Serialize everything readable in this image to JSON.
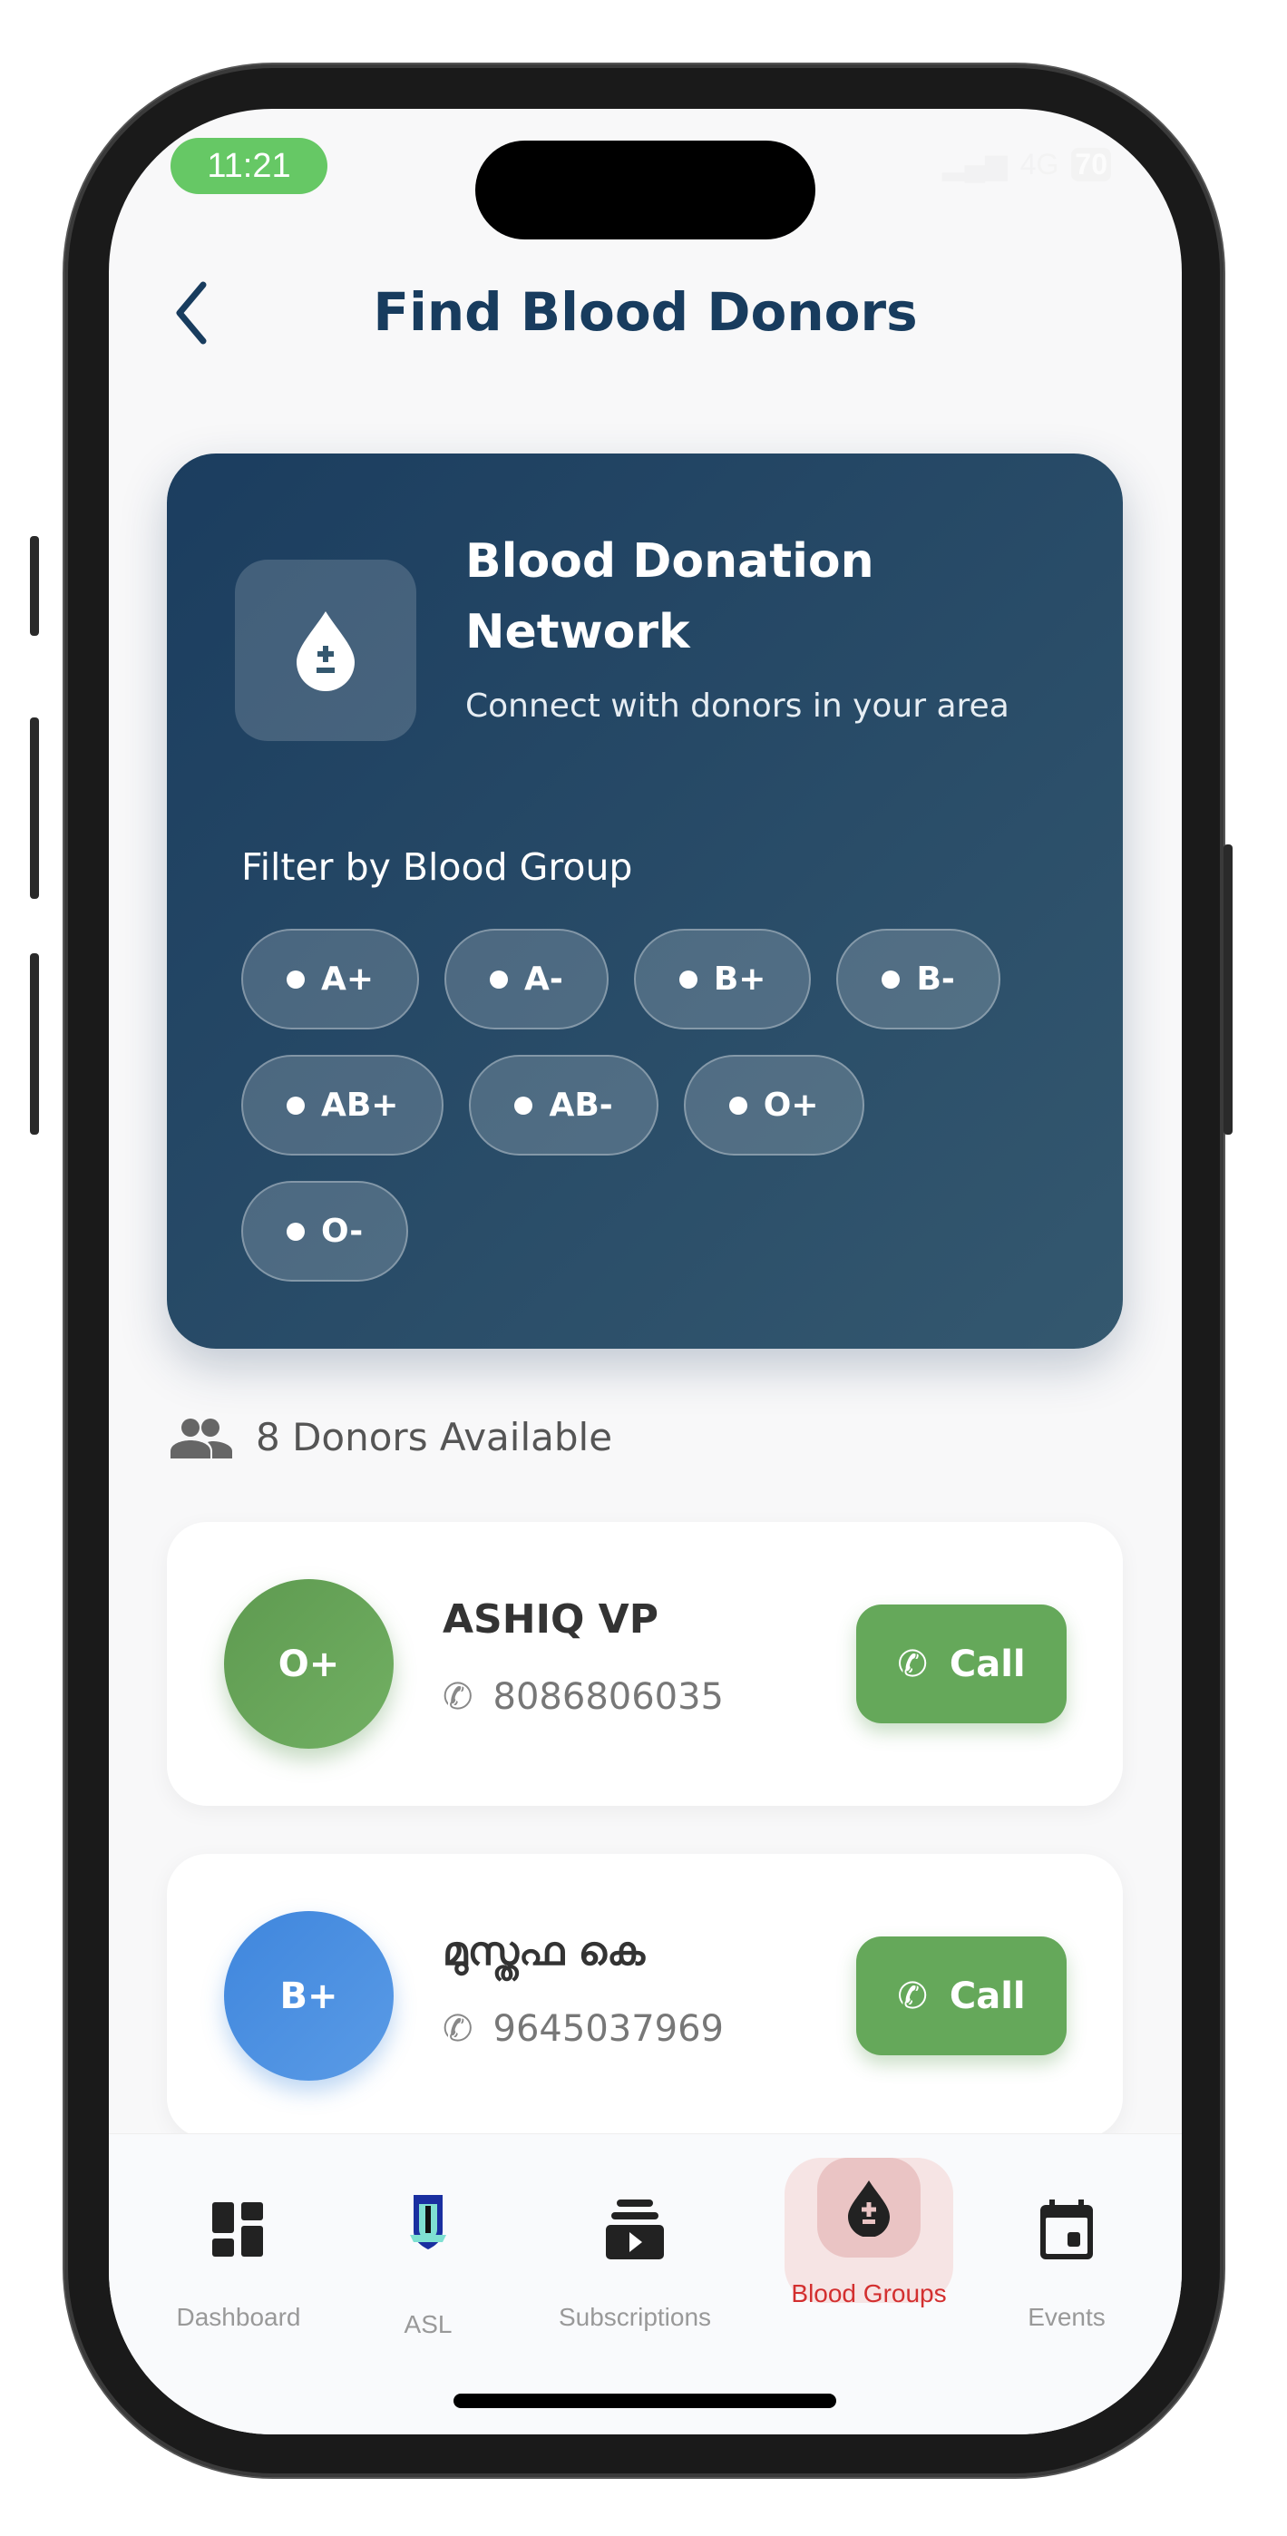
{
  "status_bar": {
    "time": "11:21",
    "network": "4G",
    "battery": "70"
  },
  "header": {
    "back_icon": "chevron-left",
    "title": "Find Blood Donors"
  },
  "hero": {
    "title": "Blood Donation Network",
    "subtitle": "Connect with donors in your area",
    "filter_label": "Filter by Blood Group",
    "chips": [
      "A+",
      "A-",
      "B+",
      "B-",
      "AB+",
      "AB-",
      "O+",
      "O-"
    ]
  },
  "donors_count": "8 Donors Available",
  "donors": [
    {
      "group": "O+",
      "name": "ASHIQ VP",
      "phone": "8086806035",
      "call": "Call",
      "color": "#65a85a"
    },
    {
      "group": "B+",
      "name": "മുസ്തഫ കെ",
      "phone": "9645037969",
      "call": "Call",
      "color": "#4a8fe0"
    }
  ],
  "nav": {
    "items": [
      {
        "label": "Dashboard",
        "icon": "dashboard-icon"
      },
      {
        "label": "ASL",
        "icon": "club-logo"
      },
      {
        "label": "Subscriptions",
        "icon": "subscriptions-icon"
      },
      {
        "label": "Blood Groups",
        "icon": "blood-drop-icon",
        "active": true
      },
      {
        "label": "Events",
        "icon": "calendar-icon"
      }
    ]
  },
  "colors": {
    "primary": "#183c5e",
    "active": "#d32f2f",
    "call": "#65a85a"
  }
}
